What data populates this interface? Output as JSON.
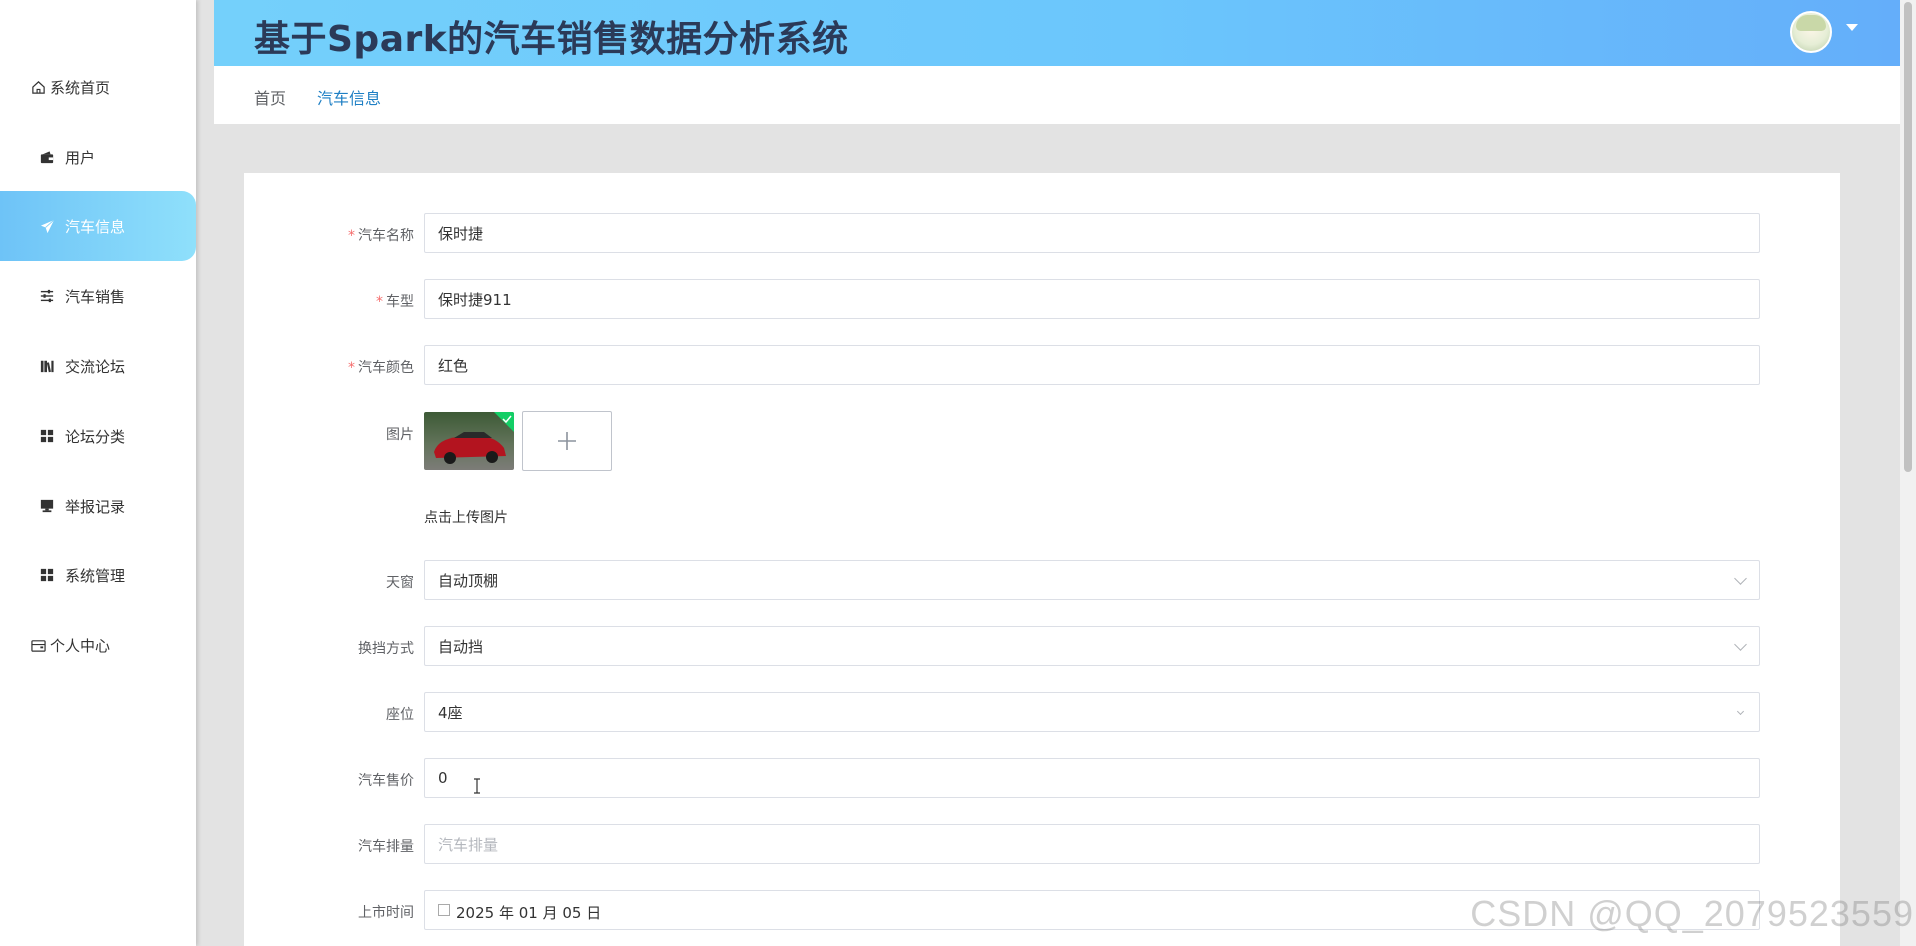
{
  "app": {
    "title": "基于Spark的汽车销售数据分析系统"
  },
  "sidebar": {
    "items": [
      {
        "label": "系统首页",
        "icon": "home-icon"
      },
      {
        "label": "用户",
        "icon": "wallet-icon"
      },
      {
        "label": "汽车信息",
        "icon": "send-icon",
        "active": true
      },
      {
        "label": "汽车销售",
        "icon": "sliders-icon"
      },
      {
        "label": "交流论坛",
        "icon": "library-icon"
      },
      {
        "label": "论坛分类",
        "icon": "grid-icon"
      },
      {
        "label": "举报记录",
        "icon": "monitor-icon"
      },
      {
        "label": "系统管理",
        "icon": "grid-icon"
      },
      {
        "label": "个人中心",
        "icon": "card-icon"
      }
    ]
  },
  "breadcrumb": {
    "home": "首页",
    "current": "汽车信息"
  },
  "form": {
    "car_name": {
      "label": "汽车名称",
      "value": "保时捷",
      "required": true
    },
    "model": {
      "label": "车型",
      "value": "保时捷911",
      "required": true
    },
    "color": {
      "label": "汽车颜色",
      "value": "红色",
      "required": true
    },
    "image": {
      "label": "图片",
      "upload_hint": "点击上传图片"
    },
    "sunroof": {
      "label": "天窗",
      "value": "自动顶棚"
    },
    "transmission": {
      "label": "换挡方式",
      "value": "自动挡"
    },
    "seats": {
      "label": "座位",
      "value": "4座"
    },
    "price": {
      "label": "汽车售价",
      "value": "0"
    },
    "displacement": {
      "label": "汽车排量",
      "placeholder": "汽车排量"
    },
    "launch_date": {
      "label": "上市时间",
      "value": "2025 年 01 月 05 日"
    }
  },
  "watermark": "CSDN @QQ_2079523559",
  "colors": {
    "header_gradient_start": "#74d0fb",
    "header_gradient_end": "#64aefa",
    "active_nav_start": "#6ec3f7",
    "active_nav_end": "#8fe0fb",
    "required": "#f56c6c",
    "breadcrumb_active": "#1e7fc4",
    "title_text": "#2b3a58"
  }
}
